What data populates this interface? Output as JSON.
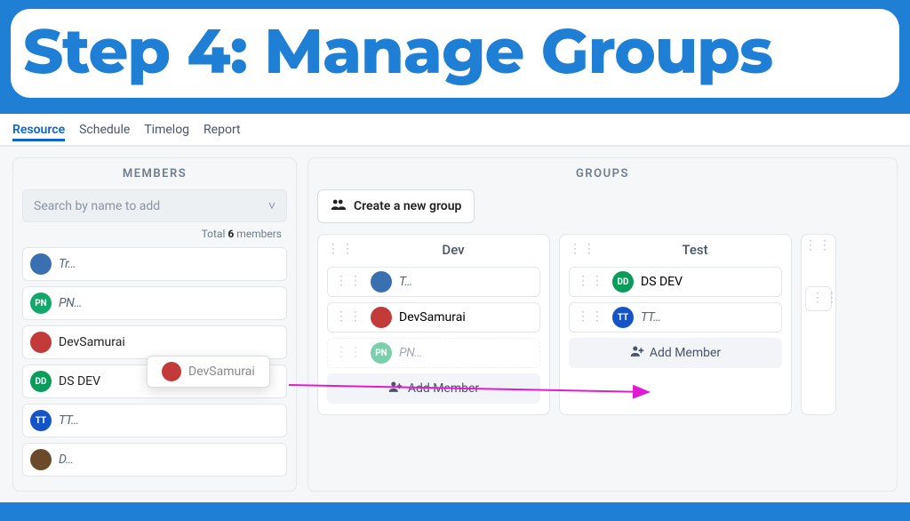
{
  "banner": {
    "title": "Step 4: Manage Groups"
  },
  "tabs": [
    "Resource",
    "Schedule",
    "Timelog",
    "Report"
  ],
  "active_tab": 0,
  "members_panel": {
    "title": "MEMBERS",
    "search_placeholder": "Search by name to add",
    "total_label_a": "Total ",
    "total_count": "6",
    "total_label_b": " members",
    "list": [
      {
        "name": "Tr…",
        "avatar_bg": "#3a6fb0",
        "initials": ""
      },
      {
        "name": "PN…",
        "avatar_bg": "#12a86b",
        "initials": "PN"
      },
      {
        "name": "DevSamurai",
        "avatar_bg": "#c33a3a",
        "initials": ""
      },
      {
        "name": "DS DEV",
        "avatar_bg": "#0a9c5b",
        "initials": "DD"
      },
      {
        "name": "TT…",
        "avatar_bg": "#1554c7",
        "initials": "TT"
      },
      {
        "name": "D…",
        "avatar_bg": "#6a4a2a",
        "initials": ""
      }
    ],
    "drag_ghost_label": "DevSamurai"
  },
  "groups_panel": {
    "title": "GROUPS",
    "create_label": "Create a new group",
    "add_member_label": "Add Member",
    "groups": [
      {
        "name": "Dev",
        "members": [
          {
            "name": "T…",
            "avatar_bg": "#3a6fb0",
            "initials": ""
          },
          {
            "name": "DevSamurai",
            "avatar_bg": "#c33a3a",
            "initials": ""
          },
          {
            "name": "PN…",
            "avatar_bg": "#12a86b",
            "initials": "PN",
            "dragging": true
          }
        ]
      },
      {
        "name": "Test",
        "members": [
          {
            "name": "DS DEV",
            "avatar_bg": "#0a9c5b",
            "initials": "DD"
          },
          {
            "name": "TT…",
            "avatar_bg": "#1554c7",
            "initials": "TT"
          }
        ]
      }
    ]
  },
  "colors": {
    "accent": "#1e7fd4"
  }
}
